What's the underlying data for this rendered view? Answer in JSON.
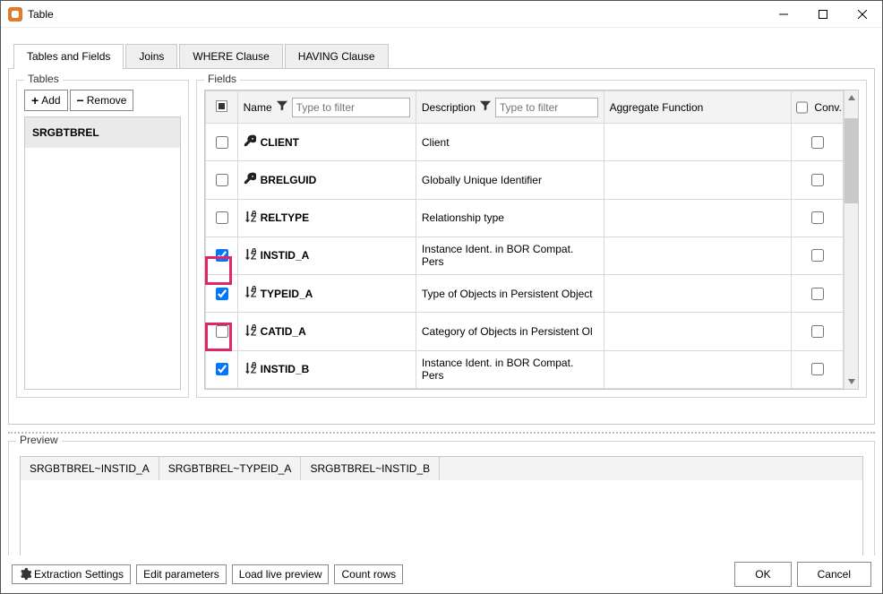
{
  "window": {
    "title": "Table"
  },
  "tabs": [
    "Tables and Fields",
    "Joins",
    "WHERE Clause",
    "HAVING Clause"
  ],
  "activeTab": 0,
  "tablesPanel": {
    "legend": "Tables",
    "addLabel": "Add",
    "removeLabel": "Remove",
    "items": [
      "SRGBTBREL"
    ]
  },
  "fieldsPanel": {
    "legend": "Fields",
    "headers": {
      "name": "Name",
      "description": "Description",
      "aggregate": "Aggregate Function",
      "conv": "Conv."
    },
    "filterPlaceholder": "Type to filter",
    "rows": [
      {
        "checked": false,
        "icon": "key",
        "name": "CLIENT",
        "desc": "Client",
        "conv": false
      },
      {
        "checked": false,
        "icon": "key",
        "name": "BRELGUID",
        "desc": "Globally Unique Identifier",
        "conv": false
      },
      {
        "checked": false,
        "icon": "sort",
        "name": "RELTYPE",
        "desc": "Relationship type",
        "conv": false
      },
      {
        "checked": true,
        "icon": "sort",
        "name": "INSTID_A",
        "desc": "Instance Ident. in BOR Compat. Pers",
        "conv": false
      },
      {
        "checked": true,
        "icon": "sort",
        "name": "TYPEID_A",
        "desc": "Type of Objects in Persistent Object",
        "conv": false,
        "highlight": true
      },
      {
        "checked": false,
        "icon": "sort",
        "name": "CATID_A",
        "desc": "Category of Objects in Persistent Ol",
        "conv": false
      },
      {
        "checked": true,
        "icon": "sort",
        "name": "INSTID_B",
        "desc": "Instance Ident. in BOR Compat. Pers",
        "conv": false,
        "highlight": true
      }
    ]
  },
  "preview": {
    "legend": "Preview",
    "columns": [
      "SRGBTBREL~INSTID_A",
      "SRGBTBREL~TYPEID_A",
      "SRGBTBREL~INSTID_B"
    ]
  },
  "bottom": {
    "extraction": "Extraction Settings",
    "editParams": "Edit parameters",
    "loadPreview": "Load live preview",
    "countRows": "Count rows",
    "ok": "OK",
    "cancel": "Cancel"
  }
}
